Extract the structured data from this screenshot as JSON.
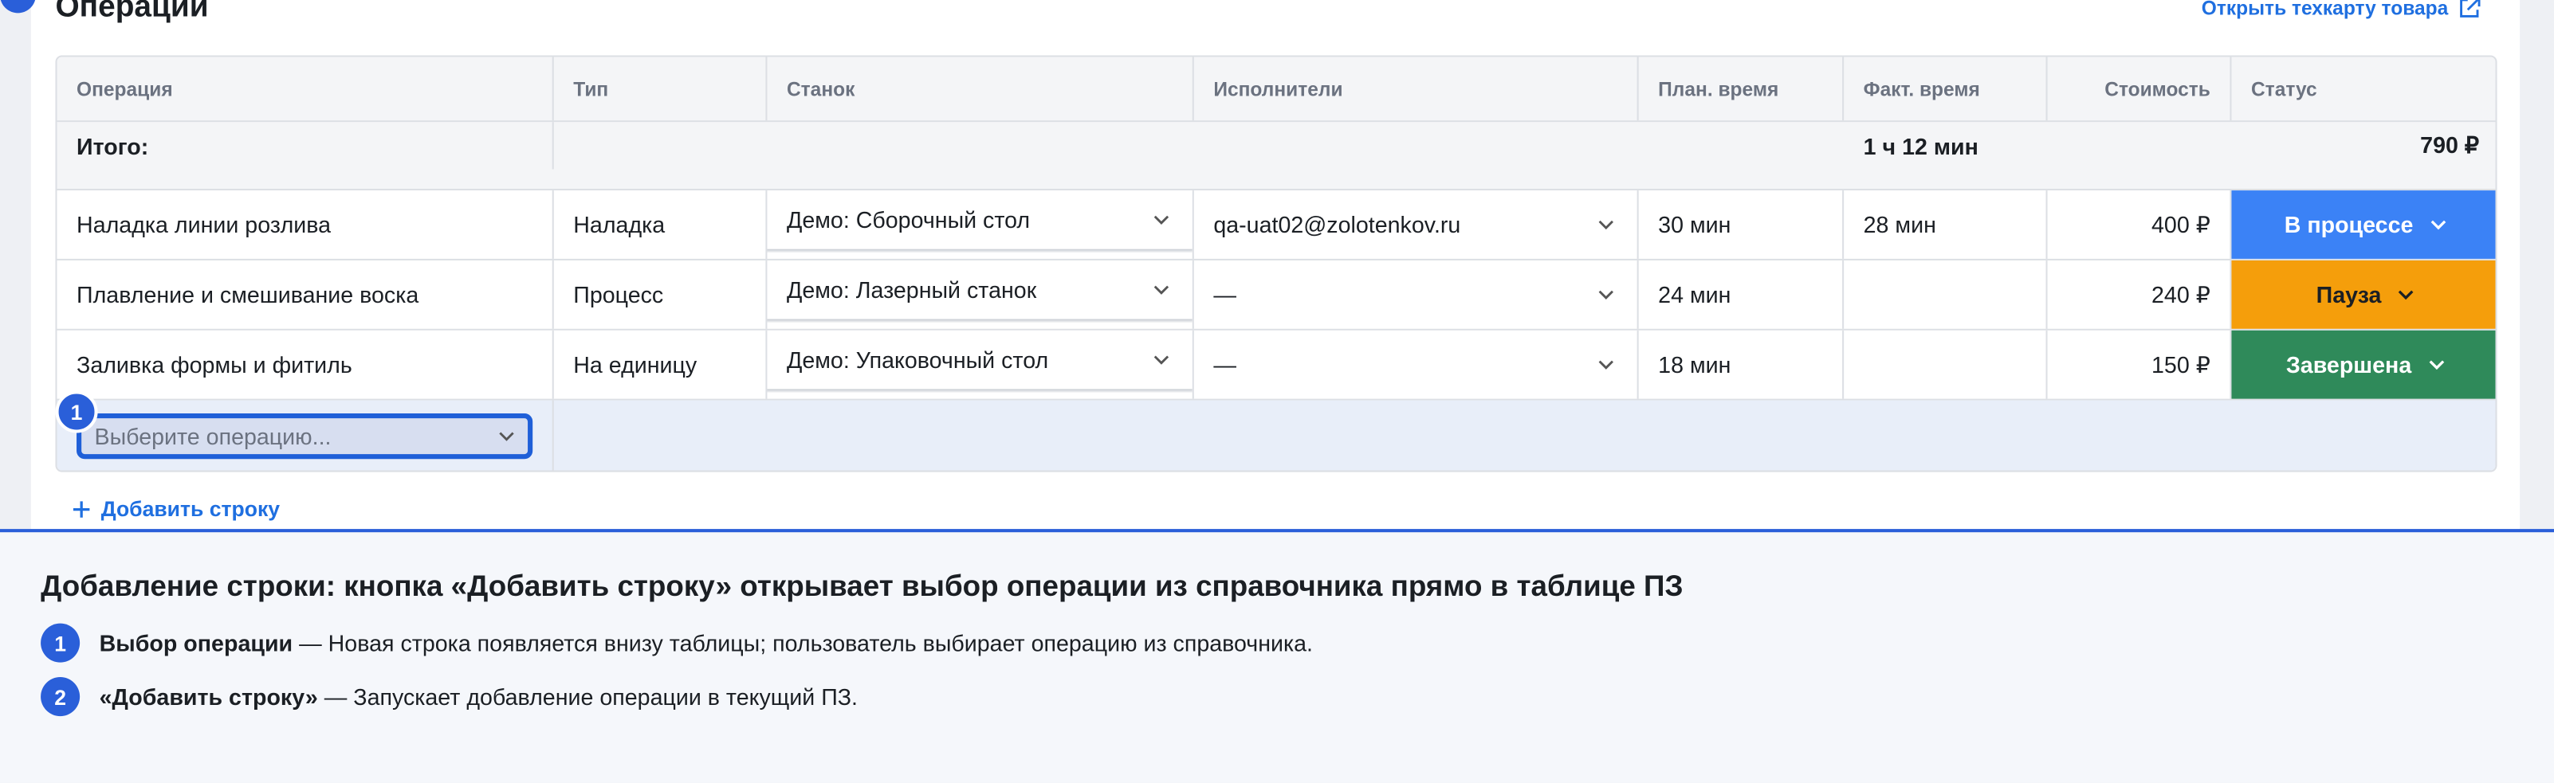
{
  "section": {
    "title": "Операции",
    "techcard_link": "Открыть техкарту товара"
  },
  "table": {
    "headers": [
      "Операция",
      "Тип",
      "Станок",
      "Исполнители",
      "План. время",
      "Факт. время",
      "Стоимость",
      "Статус"
    ],
    "total": {
      "label": "Итого:",
      "plan": "1 ч 12 мин",
      "cost": "790 ₽"
    },
    "rows": [
      {
        "operation": "Наладка линии розлива",
        "type": "Наладка",
        "machine": "Демо: Сборочный стол",
        "executor": "qa-uat02@zolotenkov.ru",
        "plan": "30 мин",
        "fact": "28 мин",
        "cost": "400 ₽",
        "status": "В процессе"
      },
      {
        "operation": "Плавление и смешивание воска",
        "type": "Процесс",
        "machine": "Демо: Лазерный станок",
        "executor": "—",
        "plan": "24 мин",
        "fact": "",
        "cost": "240 ₽",
        "status": "Пауза"
      },
      {
        "operation": "Заливка формы и фитиль",
        "type": "На единицу",
        "machine": "Демо: Упаковочный стол",
        "executor": "—",
        "plan": "18 мин",
        "fact": "",
        "cost": "150 ₽",
        "status": "Завершена"
      }
    ],
    "new_row": {
      "placeholder": "Выберите операцию..."
    }
  },
  "add_row_label": "Добавить строку",
  "badges": {
    "one": "1",
    "two": "2"
  },
  "footer": {
    "title": "Добавление строки: кнопка «Добавить строку» открывает выбор операции из справочника прямо в таблице ПЗ",
    "items": [
      {
        "num": "1",
        "bold": "Выбор операции",
        "text": "— Новая строка появляется внизу таблицы; пользователь выбирает операцию из справочника."
      },
      {
        "num": "2",
        "bold": "«Добавить строку»",
        "text": "— Запускает добавление операции в текущий ПЗ."
      }
    ]
  },
  "colors": {
    "accent": "#2a5fd9",
    "status_in_progress": "#3b82f6",
    "status_pause": "#f59e0b",
    "status_done": "#2f8a5a"
  },
  "icons": [
    "external-link-icon",
    "chevron-down-icon",
    "plus-icon"
  ]
}
